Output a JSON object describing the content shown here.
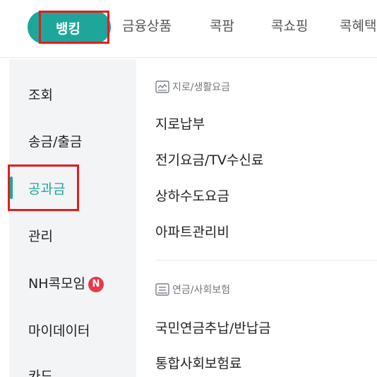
{
  "top_tabs": {
    "active": "뱅킹",
    "items": [
      "금융상품",
      "콕팜",
      "콕쇼핑",
      "콕혜택"
    ]
  },
  "sidebar": {
    "items": [
      "조회",
      "송금/출금",
      "공과금",
      "관리",
      "NH콕모임",
      "마이데이터",
      "카드"
    ],
    "active": "공과금",
    "badge": "N"
  },
  "sections": [
    {
      "title": "지로/생활요금",
      "icon": "receipt-icon",
      "links": [
        "지로납부",
        "전기요금/TV수신료",
        "상하수도요금",
        "아파트관리비"
      ]
    },
    {
      "title": "연금/사회보험",
      "icon": "pension-icon",
      "links": [
        "국민연금추납/반납금",
        "통합사회보험료"
      ]
    }
  ],
  "colors": {
    "accent": "#1fa69a",
    "highlight": "#e01e1e",
    "badge": "#e8394a"
  }
}
